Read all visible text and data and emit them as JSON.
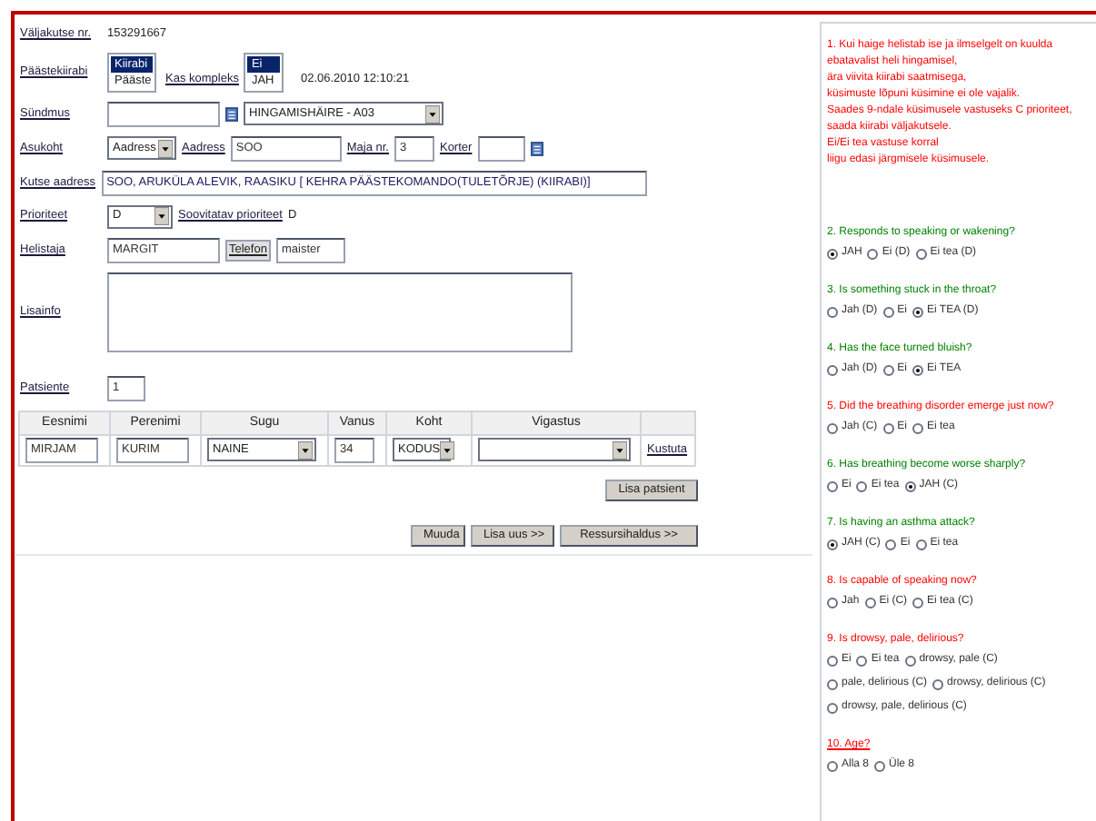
{
  "call": {
    "label": "Väljakutse nr.",
    "value": "153291667"
  },
  "brigade": {
    "label": "Päästekiirabi",
    "options": [
      {
        "label": "Kiirabi",
        "selected": true
      },
      {
        "label": "Pääste",
        "selected": false
      }
    ]
  },
  "complex": {
    "label": "Kas kompleks",
    "options": [
      {
        "label": "Ei",
        "selected": true
      },
      {
        "label": "JAH",
        "selected": false
      }
    ]
  },
  "timestamp": "02.06.2010 12:10:21",
  "event": {
    "label": "Sündmus",
    "select": "HINGAMISHÄIRE - A03"
  },
  "location": {
    "label": "Asukoht",
    "select": "Aadress",
    "address_label": "Aadress",
    "address": "SOO",
    "house_label": "Maja nr.",
    "house": "3",
    "apartment_label": "Korter"
  },
  "call_address": {
    "label": "Kutse aadress",
    "value": "SOO, ARUKÜLA ALEVIK, RAASIKU [ KEHRA PÄÄSTEKOMANDO(TULETÕRJE) (KIIRABI)]"
  },
  "priority": {
    "label": "Prioriteet",
    "select": "D",
    "suggested_label": "Soovitatav prioriteet",
    "suggested": "D"
  },
  "caller": {
    "label": "Helistaja",
    "value": "MARGIT",
    "phone_label": "Telefon",
    "phone": "maister"
  },
  "extra": {
    "label": "Lisainfo"
  },
  "patients": {
    "label": "Patsiente",
    "value": "1"
  },
  "table": {
    "columns": [
      "Eesnimi",
      "Perenimi",
      "Sugu",
      "Vanus",
      "Koht",
      "Vigastus"
    ],
    "rows": [
      {
        "first": "MIRJAM",
        "last": "KURIM",
        "sex": "NAINE",
        "age": "34",
        "place": "KODUS",
        "action": "Kustuta"
      }
    ]
  },
  "add_patient": "Lisa patsient",
  "buttons": [
    "Muuda",
    "Lisa uus >>",
    "Ressursihaldus >>"
  ],
  "intro": {
    "color": "#ff0000",
    "lines": [
      "1. Kui haige helistab ise ja ilmselgelt on kuulda",
      "ebatavalist heli hingamisel,",
      "ära viivita kiirabi saatmisega,",
      "küsimuste lõpuni küsimine ei ole vajalik.",
      "Saades 9-ndale küsimusele vastuseks C prioriteet,",
      "saada kiirabi väljakutsele.",
      "Ei/Ei tea vastuse korral",
      "liigu edasi järgmisele küsimusele."
    ]
  },
  "questions": [
    {
      "text": "2. Responds to speaking or wakening?",
      "color": "#008000",
      "underlined": false,
      "options": [
        {
          "label": "JAH",
          "selected": true
        },
        {
          "label": "Ei (D)",
          "selected": false
        },
        {
          "label": "Ei tea (D)",
          "selected": false
        }
      ]
    },
    {
      "text": "3. Is something stuck in the throat?",
      "color": "#008000",
      "underlined": false,
      "options": [
        {
          "label": "Jah (D)",
          "selected": false
        },
        {
          "label": "Ei",
          "selected": false
        },
        {
          "label": "Ei TEA (D)",
          "selected": true
        }
      ]
    },
    {
      "text": "4. Has the face turned bluish?",
      "color": "#008000",
      "underlined": false,
      "options": [
        {
          "label": "Jah (D)",
          "selected": false
        },
        {
          "label": "Ei",
          "selected": false
        },
        {
          "label": "Ei TEA",
          "selected": true
        }
      ]
    },
    {
      "text": "5. Did the breathing disorder emerge just now?",
      "color": "#ff0000",
      "underlined": false,
      "options": [
        {
          "label": "Jah (C)",
          "selected": false
        },
        {
          "label": "Ei",
          "selected": false
        },
        {
          "label": "Ei tea",
          "selected": false
        }
      ]
    },
    {
      "text": "6. Has breathing become worse sharply?",
      "color": "#008000",
      "underlined": false,
      "options": [
        {
          "label": "Ei",
          "selected": false
        },
        {
          "label": "Ei tea",
          "selected": false
        },
        {
          "label": "JAH (C)",
          "selected": true
        }
      ]
    },
    {
      "text": "7. Is having an asthma attack?",
      "color": "#008000",
      "underlined": false,
      "options": [
        {
          "label": "JAH (C)",
          "selected": true
        },
        {
          "label": "Ei",
          "selected": false
        },
        {
          "label": "Ei tea",
          "selected": false
        }
      ]
    },
    {
      "text": "8. Is capable of speaking now?",
      "color": "#ff0000",
      "underlined": false,
      "options": [
        {
          "label": "Jah",
          "selected": false
        },
        {
          "label": "Ei (C)",
          "selected": false
        },
        {
          "label": "Ei tea (C)",
          "selected": false
        }
      ]
    },
    {
      "text": "9. Is drowsy, pale, delirious?",
      "color": "#ff0000",
      "underlined": false,
      "options": [
        {
          "label": "Ei",
          "selected": false
        },
        {
          "label": "Ei tea",
          "selected": false
        },
        {
          "label": "drowsy, pale (C)",
          "selected": false
        },
        {
          "label": "pale, delirious (C)",
          "selected": false
        },
        {
          "label": "drowsy, delirious (C)",
          "selected": false
        },
        {
          "label": "drowsy, pale, delirious (C)",
          "selected": false
        }
      ]
    },
    {
      "text": "10. Age?",
      "color": "#ff0000",
      "underlined": true,
      "options": [
        {
          "label": "Alla 8",
          "selected": false
        },
        {
          "label": "Üle 8",
          "selected": false
        }
      ]
    }
  ]
}
